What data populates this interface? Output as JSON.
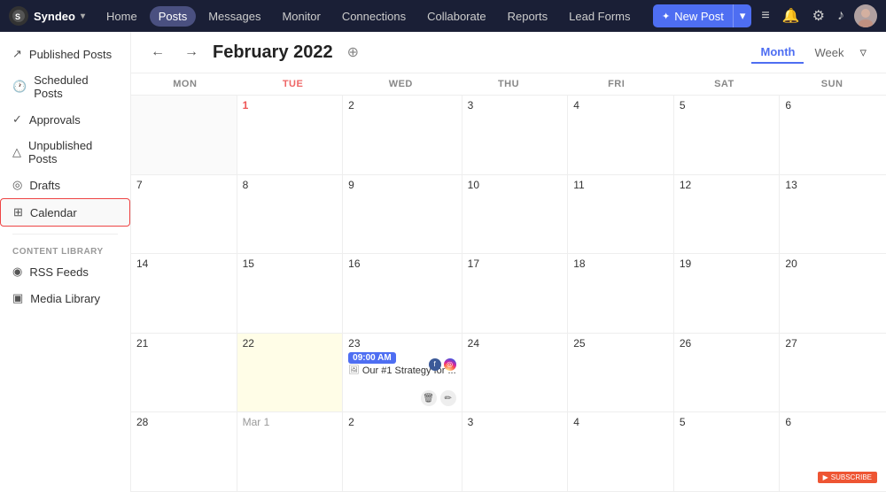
{
  "app": {
    "name": "Syndeo",
    "chevron": "▾"
  },
  "nav": {
    "items": [
      {
        "label": "Home",
        "active": false
      },
      {
        "label": "Posts",
        "active": true
      },
      {
        "label": "Messages",
        "active": false
      },
      {
        "label": "Monitor",
        "active": false
      },
      {
        "label": "Connections",
        "active": false
      },
      {
        "label": "Collaborate",
        "active": false
      },
      {
        "label": "Reports",
        "active": false
      },
      {
        "label": "Lead Forms",
        "active": false
      }
    ],
    "new_post_label": "New Post",
    "new_post_icon": "✦"
  },
  "sidebar": {
    "items": [
      {
        "label": "Published Posts",
        "icon": "↗",
        "active": false
      },
      {
        "label": "Scheduled Posts",
        "icon": "🕐",
        "active": false
      },
      {
        "label": "Approvals",
        "icon": "✓",
        "active": false
      },
      {
        "label": "Unpublished Posts",
        "icon": "△",
        "active": false
      },
      {
        "label": "Drafts",
        "icon": "◎",
        "active": false
      },
      {
        "label": "Calendar",
        "icon": "⊞",
        "active": true
      }
    ],
    "section_label": "CONTENT LIBRARY",
    "library_items": [
      {
        "label": "RSS Feeds",
        "icon": "◉"
      },
      {
        "label": "Media Library",
        "icon": "▣"
      }
    ]
  },
  "calendar": {
    "title": "February 2022",
    "view_month": "Month",
    "view_week": "Week",
    "days": [
      "MON",
      "TUE",
      "WED",
      "THU",
      "FRI",
      "SAT",
      "SUN"
    ],
    "today_day_index": 1,
    "cells": [
      {
        "num": "",
        "dimmed": true
      },
      {
        "num": "1",
        "today": true
      },
      {
        "num": "2"
      },
      {
        "num": "3"
      },
      {
        "num": "4"
      },
      {
        "num": "5"
      },
      {
        "num": "6"
      },
      {
        "num": "7"
      },
      {
        "num": "8"
      },
      {
        "num": "9"
      },
      {
        "num": "10"
      },
      {
        "num": "11"
      },
      {
        "num": "12"
      },
      {
        "num": "13"
      },
      {
        "num": "14"
      },
      {
        "num": "15"
      },
      {
        "num": "16"
      },
      {
        "num": "17"
      },
      {
        "num": "18"
      },
      {
        "num": "19"
      },
      {
        "num": "20"
      },
      {
        "num": "21"
      },
      {
        "num": "22",
        "highlighted": true
      },
      {
        "num": "23",
        "has_event": true
      },
      {
        "num": "24"
      },
      {
        "num": "25"
      },
      {
        "num": "26"
      },
      {
        "num": "27"
      },
      {
        "num": "28"
      },
      {
        "num": "Mar 1"
      },
      {
        "num": "2"
      },
      {
        "num": "3"
      },
      {
        "num": "4"
      },
      {
        "num": "5"
      },
      {
        "num": "6"
      }
    ],
    "event": {
      "time": "09:00 AM",
      "title": "Our #1 Strategy for ...",
      "has_image": true
    }
  }
}
